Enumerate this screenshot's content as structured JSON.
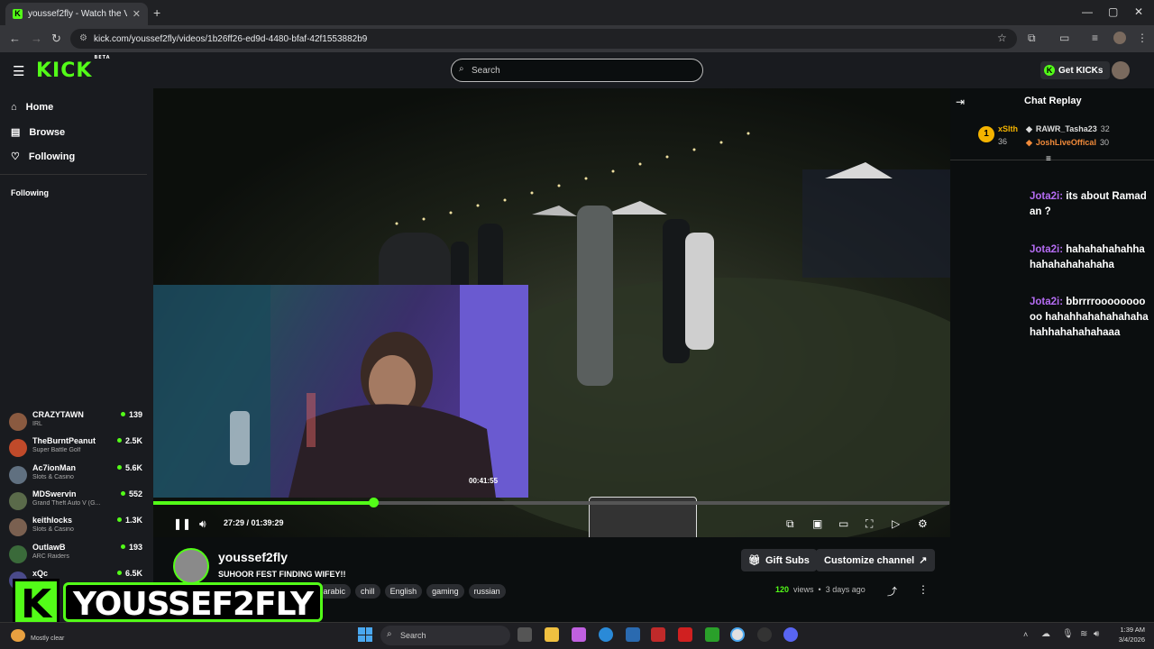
{
  "browser": {
    "tab_title": "youssef2fly - Watch the VO",
    "url": "kick.com/youssef2fly/videos/1b26ff26-ed9d-4480-bfaf-42f1553882b9"
  },
  "header": {
    "logo": "KICK",
    "logo_beta": "BETA",
    "search_placeholder": "Search",
    "get_kicks": "Get KICKs"
  },
  "sidebar": {
    "nav": [
      {
        "label": "Home",
        "icon": "home-icon"
      },
      {
        "label": "Browse",
        "icon": "compass-icon"
      },
      {
        "label": "Following",
        "icon": "heart-icon"
      }
    ],
    "following_title": "Following",
    "channels": [
      {
        "name": "CRAZYTAWN",
        "category": "IRL",
        "viewers": "139",
        "color": "#8a5a40"
      },
      {
        "name": "TheBurntPeanut",
        "category": "Super Battle Golf",
        "viewers": "2.5K",
        "color": "#c04a2a"
      },
      {
        "name": "Ac7ionMan",
        "category": "Slots & Casino",
        "viewers": "5.6K",
        "color": "#607080"
      },
      {
        "name": "MDSwervin",
        "category": "Grand Theft Auto V (G...",
        "viewers": "552",
        "color": "#5a6a4a"
      },
      {
        "name": "keithlocks",
        "category": "Slots & Casino",
        "viewers": "1.3K",
        "color": "#7a6050"
      },
      {
        "name": "OutlawB",
        "category": "ARC Raiders",
        "viewers": "193",
        "color": "#3a6a3a"
      },
      {
        "name": "xQc",
        "category": "",
        "viewers": "6.5K",
        "color": "#4a4a8a"
      }
    ]
  },
  "player": {
    "preview_time": "00:41:55",
    "timecode": "27:29 / 01:39:29",
    "progress": 0.276
  },
  "stream": {
    "channel": "youssef2fly",
    "title": "SUHOOR FEST FINDING WIFEY!!",
    "tags": [
      "English",
      "arabic",
      "chill",
      "English",
      "gaming",
      "russian"
    ],
    "gift_subs": "Gift Subs",
    "customize": "Customize channel",
    "views_count": "120",
    "views_label": "views",
    "age": "3 days ago"
  },
  "overlay": {
    "brand_letter": "K",
    "brand_name": "YOUSSEF2FLY"
  },
  "chat": {
    "title": "Chat Replay",
    "leaderboard": {
      "top_name": "xSlth",
      "top_count": "36",
      "second_name": "RAWR_Tasha23",
      "second_count": "32",
      "third_name": "JoshLiveOffical",
      "third_count": "30"
    },
    "messages": [
      {
        "user": "Jota2i:",
        "text": "its about Ramadan ?"
      },
      {
        "user": "Jota2i:",
        "text": "hahahahahahhahahahahahahaha"
      },
      {
        "user": "Jota2i:",
        "text": "bbrrrroooooooooo hahahhahahahahahahahhahahahahaaa"
      }
    ]
  },
  "taskbar": {
    "weather": "Mostly clear",
    "search": "Search",
    "time": "1:39 AM",
    "date": "3/4/2026"
  }
}
